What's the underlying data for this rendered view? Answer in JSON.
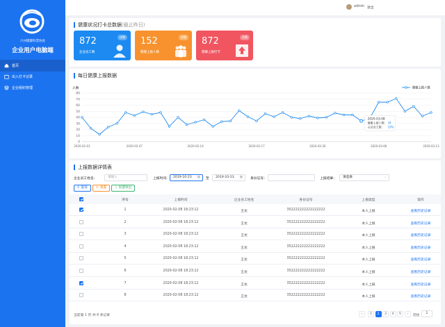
{
  "sidebar": {
    "org": "六州健康科普协会",
    "title": "企业用户电脑端",
    "items": [
      {
        "label": "首页"
      },
      {
        "label": "出入打卡记录"
      },
      {
        "label": "企业组织管理"
      }
    ]
  },
  "topbar": {
    "user": "admin",
    "logout": "退出"
  },
  "summary": {
    "title": "健康状况打卡总数据",
    "subtitle": "(截止昨日)",
    "cards": [
      {
        "value": "872",
        "label": "企业员工数",
        "pill": "详情",
        "color": "#1c8af0"
      },
      {
        "value": "152",
        "label": "健康上报人数",
        "pill": "详情",
        "color": "#f7922e"
      },
      {
        "value": "872",
        "label": "健康上报打卡",
        "pill": "详情",
        "color": "#f05560"
      }
    ]
  },
  "daily": {
    "title": "每日健康上报数据",
    "chart_data": {
      "type": "line",
      "ylabel": "人数",
      "ylim": [
        0,
        80
      ],
      "yticks": [
        0,
        10,
        20,
        30,
        40,
        50,
        60,
        70,
        80
      ],
      "xticks": [
        "2020-02-01",
        "2020-02-07",
        "2020-02-14",
        "2020-02-17",
        "2020-02-26",
        "2020-03-06",
        "2020-03-13"
      ],
      "series": [
        {
          "name": "健康上报人数",
          "values": [
            40,
            22,
            12,
            24,
            30,
            48,
            43,
            49,
            45,
            48,
            25,
            40,
            28,
            32,
            36,
            25,
            33,
            34,
            51,
            41,
            34,
            46,
            41,
            48,
            40,
            38,
            42,
            39,
            40,
            47,
            44,
            44,
            34,
            39,
            65,
            65,
            71,
            50,
            58,
            42,
            48
          ]
        }
      ],
      "tooltip": {
        "date": "2020-03-08",
        "line1_label": "健康上报人数：",
        "line1_value": "34",
        "line2_label": "占总员工数：",
        "line2_value": "19%"
      },
      "color": "#1c8af0"
    }
  },
  "detail": {
    "title": "上报数据详情表",
    "filters": {
      "name_label": "企业员工姓名：",
      "name_placeholder": "请输入",
      "time_label": "上报时间:",
      "date_from": "2019-10-23",
      "to": "至",
      "date_to": "2019-10-23",
      "id_label": "身份证号：",
      "result_label": "上报结果：",
      "result_value": "请选择"
    },
    "buttons": {
      "search": "查询",
      "reset": "重置",
      "export": "批量导出"
    },
    "columns": [
      "序号",
      "上报时间",
      "企业员工姓名",
      "身份证号",
      "上报类型",
      "操作"
    ],
    "rows": [
      {
        "checked": true,
        "no": "1",
        "time": "2020-02-08 18:23:12",
        "name": "王龙",
        "id": "352222222222222222",
        "type": "本人上报",
        "action": "查看历史记录"
      },
      {
        "checked": false,
        "no": "2",
        "time": "2020-02-08 18:23:12",
        "name": "王龙",
        "id": "352222222222222222",
        "type": "本人上报",
        "action": "查看历史记录"
      },
      {
        "checked": false,
        "no": "3",
        "time": "2020-02-08 18:23:12",
        "name": "王龙",
        "id": "352222222222222222",
        "type": "本人上报",
        "action": "查看历史记录"
      },
      {
        "checked": false,
        "no": "4",
        "time": "2020-02-08 18:23:12",
        "name": "王龙",
        "id": "352222222222222222",
        "type": "本人上报",
        "action": "查看历史记录"
      },
      {
        "checked": false,
        "no": "5",
        "time": "2020-02-08 18:23:12",
        "name": "王龙",
        "id": "352222222222222222",
        "type": "本人上报",
        "action": "查看历史记录"
      },
      {
        "checked": false,
        "no": "6",
        "time": "2020-02-08 18:23:12",
        "name": "王龙",
        "id": "352222222222222222",
        "type": "本人上报",
        "action": "查看历史记录"
      },
      {
        "checked": true,
        "no": "7",
        "time": "2020-02-08 18:23:12",
        "name": "王龙",
        "id": "352222222222222222",
        "type": "本人上报",
        "action": "查看历史记录"
      },
      {
        "checked": false,
        "no": "8",
        "time": "2020-02-08 18:23:12",
        "name": "王龙",
        "id": "352222222222222222",
        "type": "本人上报",
        "action": "查看历史记录"
      }
    ],
    "pager": {
      "info": "当前第 1 页 共 8 条记录",
      "pages": [
        "1",
        "2",
        "3",
        "4",
        "5"
      ],
      "current": "2",
      "goto": "前往",
      "page_input": "1"
    }
  }
}
